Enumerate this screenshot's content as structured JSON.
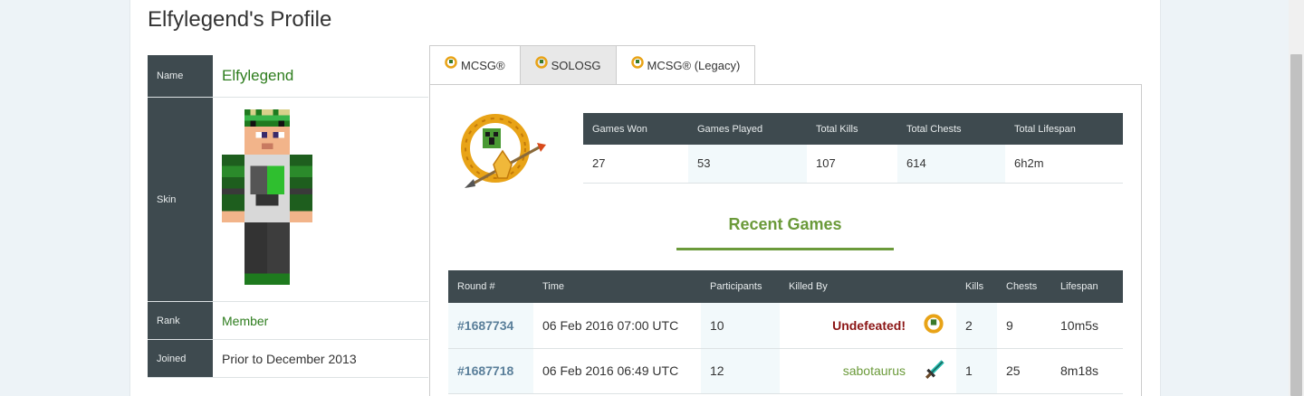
{
  "page_title": "Elfylegend's Profile",
  "profile": {
    "name_label": "Name",
    "name_value": "Elfylegend",
    "skin_label": "Skin",
    "rank_label": "Rank",
    "rank_value": "Member",
    "joined_label": "Joined",
    "joined_value": "Prior to December 2013"
  },
  "tabs": [
    {
      "label": "MCSG®",
      "active": false
    },
    {
      "label": "SOLOSG",
      "active": true
    },
    {
      "label": "MCSG® (Legacy)",
      "active": false
    }
  ],
  "stats": {
    "headers": [
      "Games Won",
      "Games Played",
      "Total Kills",
      "Total Chests",
      "Total Lifespan"
    ],
    "values": [
      "27",
      "53",
      "107",
      "614",
      "6h2m"
    ]
  },
  "recent_games_title": "Recent Games",
  "games": {
    "headers": [
      "Round #",
      "Time",
      "Participants",
      "Killed By",
      "",
      "Kills",
      "Chests",
      "Lifespan"
    ],
    "rows": [
      {
        "round": "#1687734",
        "time": "06 Feb 2016 07:00 UTC",
        "participants": "10",
        "killed_by": "Undefeated!",
        "icon": "mcsg-logo-icon",
        "kills": "2",
        "chests": "9",
        "lifespan": "10m5s"
      },
      {
        "round": "#1687718",
        "time": "06 Feb 2016 06:49 UTC",
        "participants": "12",
        "killed_by": "sabotaurus",
        "icon": "diamond-sword-icon",
        "kills": "1",
        "chests": "25",
        "lifespan": "8m18s"
      }
    ]
  },
  "colors": {
    "header_bg": "#3e4a4f",
    "accent_green": "#6b9a3a",
    "link_blue": "#5a7f9a",
    "undefeated_red": "#8b1515"
  }
}
